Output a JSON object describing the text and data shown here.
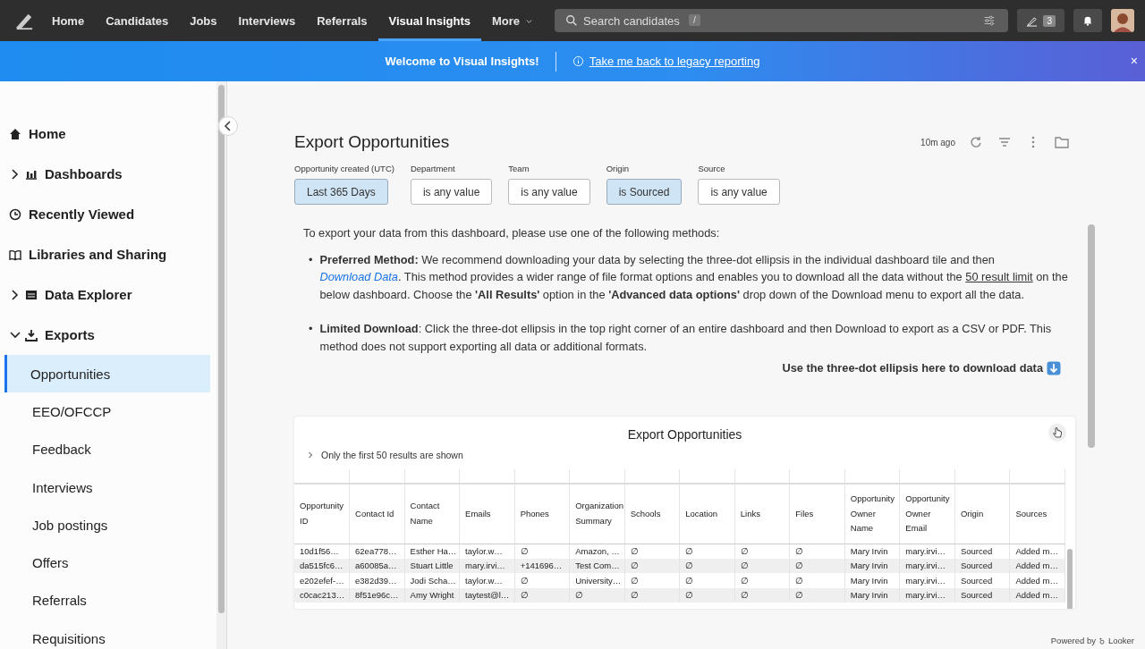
{
  "nav": {
    "items": [
      {
        "label": "Home",
        "selected": false
      },
      {
        "label": "Candidates",
        "selected": false
      },
      {
        "label": "Jobs",
        "selected": false
      },
      {
        "label": "Interviews",
        "selected": false
      },
      {
        "label": "Referrals",
        "selected": false
      },
      {
        "label": "Visual Insights",
        "selected": true
      },
      {
        "label": "More",
        "selected": false,
        "dropdown": true
      }
    ],
    "search": {
      "placeholder": "Search candidates",
      "shortcut": "/"
    },
    "compose_count": "3"
  },
  "banner": {
    "title": "Welcome to Visual Insights!",
    "link": "Take me back to legacy reporting",
    "close": "×"
  },
  "sidebar": {
    "items": [
      {
        "label": "Home",
        "kind": "link"
      },
      {
        "label": "Dashboards",
        "kind": "group",
        "expanded": false
      },
      {
        "label": "Recently Viewed",
        "kind": "link"
      },
      {
        "label": "Libraries and Sharing",
        "kind": "link"
      },
      {
        "label": "Data Explorer",
        "kind": "group",
        "expanded": false
      },
      {
        "label": "Exports",
        "kind": "group",
        "expanded": true,
        "children": [
          {
            "label": "Opportunities",
            "selected": true
          },
          {
            "label": "EEO/OFCCP",
            "selected": false
          },
          {
            "label": "Feedback",
            "selected": false
          },
          {
            "label": "Interviews",
            "selected": false
          },
          {
            "label": "Job postings",
            "selected": false
          },
          {
            "label": "Offers",
            "selected": false
          },
          {
            "label": "Referrals",
            "selected": false
          },
          {
            "label": "Requisitions",
            "selected": false
          }
        ]
      }
    ]
  },
  "dashboard": {
    "title": "Export Opportunities",
    "updated": "10m ago",
    "filters": [
      {
        "label": "Opportunity created (UTC)",
        "value": "Last 365 Days",
        "active": true
      },
      {
        "label": "Department",
        "value": "is any value",
        "active": false
      },
      {
        "label": "Team",
        "value": "is any value",
        "active": false
      },
      {
        "label": "Origin",
        "value": "is Sourced",
        "active": true
      },
      {
        "label": "Source",
        "value": "is any value",
        "active": false
      }
    ],
    "intro": "To export your data from this dashboard, please use one of the following methods:",
    "bullets": [
      {
        "marker": "•",
        "parts": [
          {
            "kind": "text",
            "text": "**Preferred Method:** We recommend downloading your data by selecting the three-dot ellipsis in the individual dashboard tile and then "
          },
          {
            "kind": "link",
            "text": "Download Data"
          },
          {
            "kind": "text",
            "text": ". This method provides a wider range of file format options and enables you to download all the data without the "
          },
          {
            "kind": "underlined",
            "text": "50 result limit"
          },
          {
            "kind": "text",
            "text": " on the below dashboard. Choose the **'All Results'** option in the **'Advanced data options'** drop down of the Download menu to export all the data."
          }
        ]
      },
      {
        "marker": "•",
        "parts": [
          {
            "kind": "text",
            "text": "**Limited Download**: Click the three-dot ellipsis in the top right corner of an entire dashboard and then Download to export as a CSV or PDF. This method does not support exporting all data or additional formats."
          }
        ]
      }
    ],
    "hint": "Use the three-dot ellipsis here to download data",
    "tile": {
      "title": "Export Opportunities",
      "note": "Only the first 50 results are shown",
      "columns": [
        "Opportunity ID",
        "Contact Id",
        "Contact Name",
        "Emails",
        "Phones",
        "Organization Summary",
        "Schools",
        "Location",
        "Links",
        "Files",
        "Opportunity Owner Name",
        "Opportunity Owner Email",
        "Origin",
        "Sources"
      ],
      "rows": [
        [
          "10d1f56…",
          "62ea778…",
          "Esther Ha…",
          "taylor.w…",
          "∅",
          "Amazon, …",
          "∅",
          "∅",
          "∅",
          "∅",
          "Mary Irvin",
          "mary.irvi…",
          "Sourced",
          "Added m…"
        ],
        [
          "da515fc6…",
          "a60085a…",
          "Stuart Little",
          "mary.irvi…",
          "+141696…",
          "Test Com…",
          "∅",
          "∅",
          "∅",
          "∅",
          "Mary Irvin",
          "mary.irvi…",
          "Sourced",
          "Added m…"
        ],
        [
          "e202efef-…",
          "e382d39…",
          "Jodi Scha…",
          "taylor.w…",
          "∅",
          "University…",
          "∅",
          "∅",
          "∅",
          "∅",
          "Mary Irvin",
          "mary.irvi…",
          "Sourced",
          "Added m…"
        ],
        [
          "c0cac213…",
          "8f51e96c…",
          "Amy Wright",
          "taytest@l…",
          "∅",
          "∅",
          "∅",
          "∅",
          "∅",
          "∅",
          "Mary Irvin",
          "mary.irvi…",
          "Sourced",
          "Added m…"
        ]
      ]
    }
  },
  "footer": {
    "powered_by": "Powered by",
    "brand": "Looker"
  }
}
